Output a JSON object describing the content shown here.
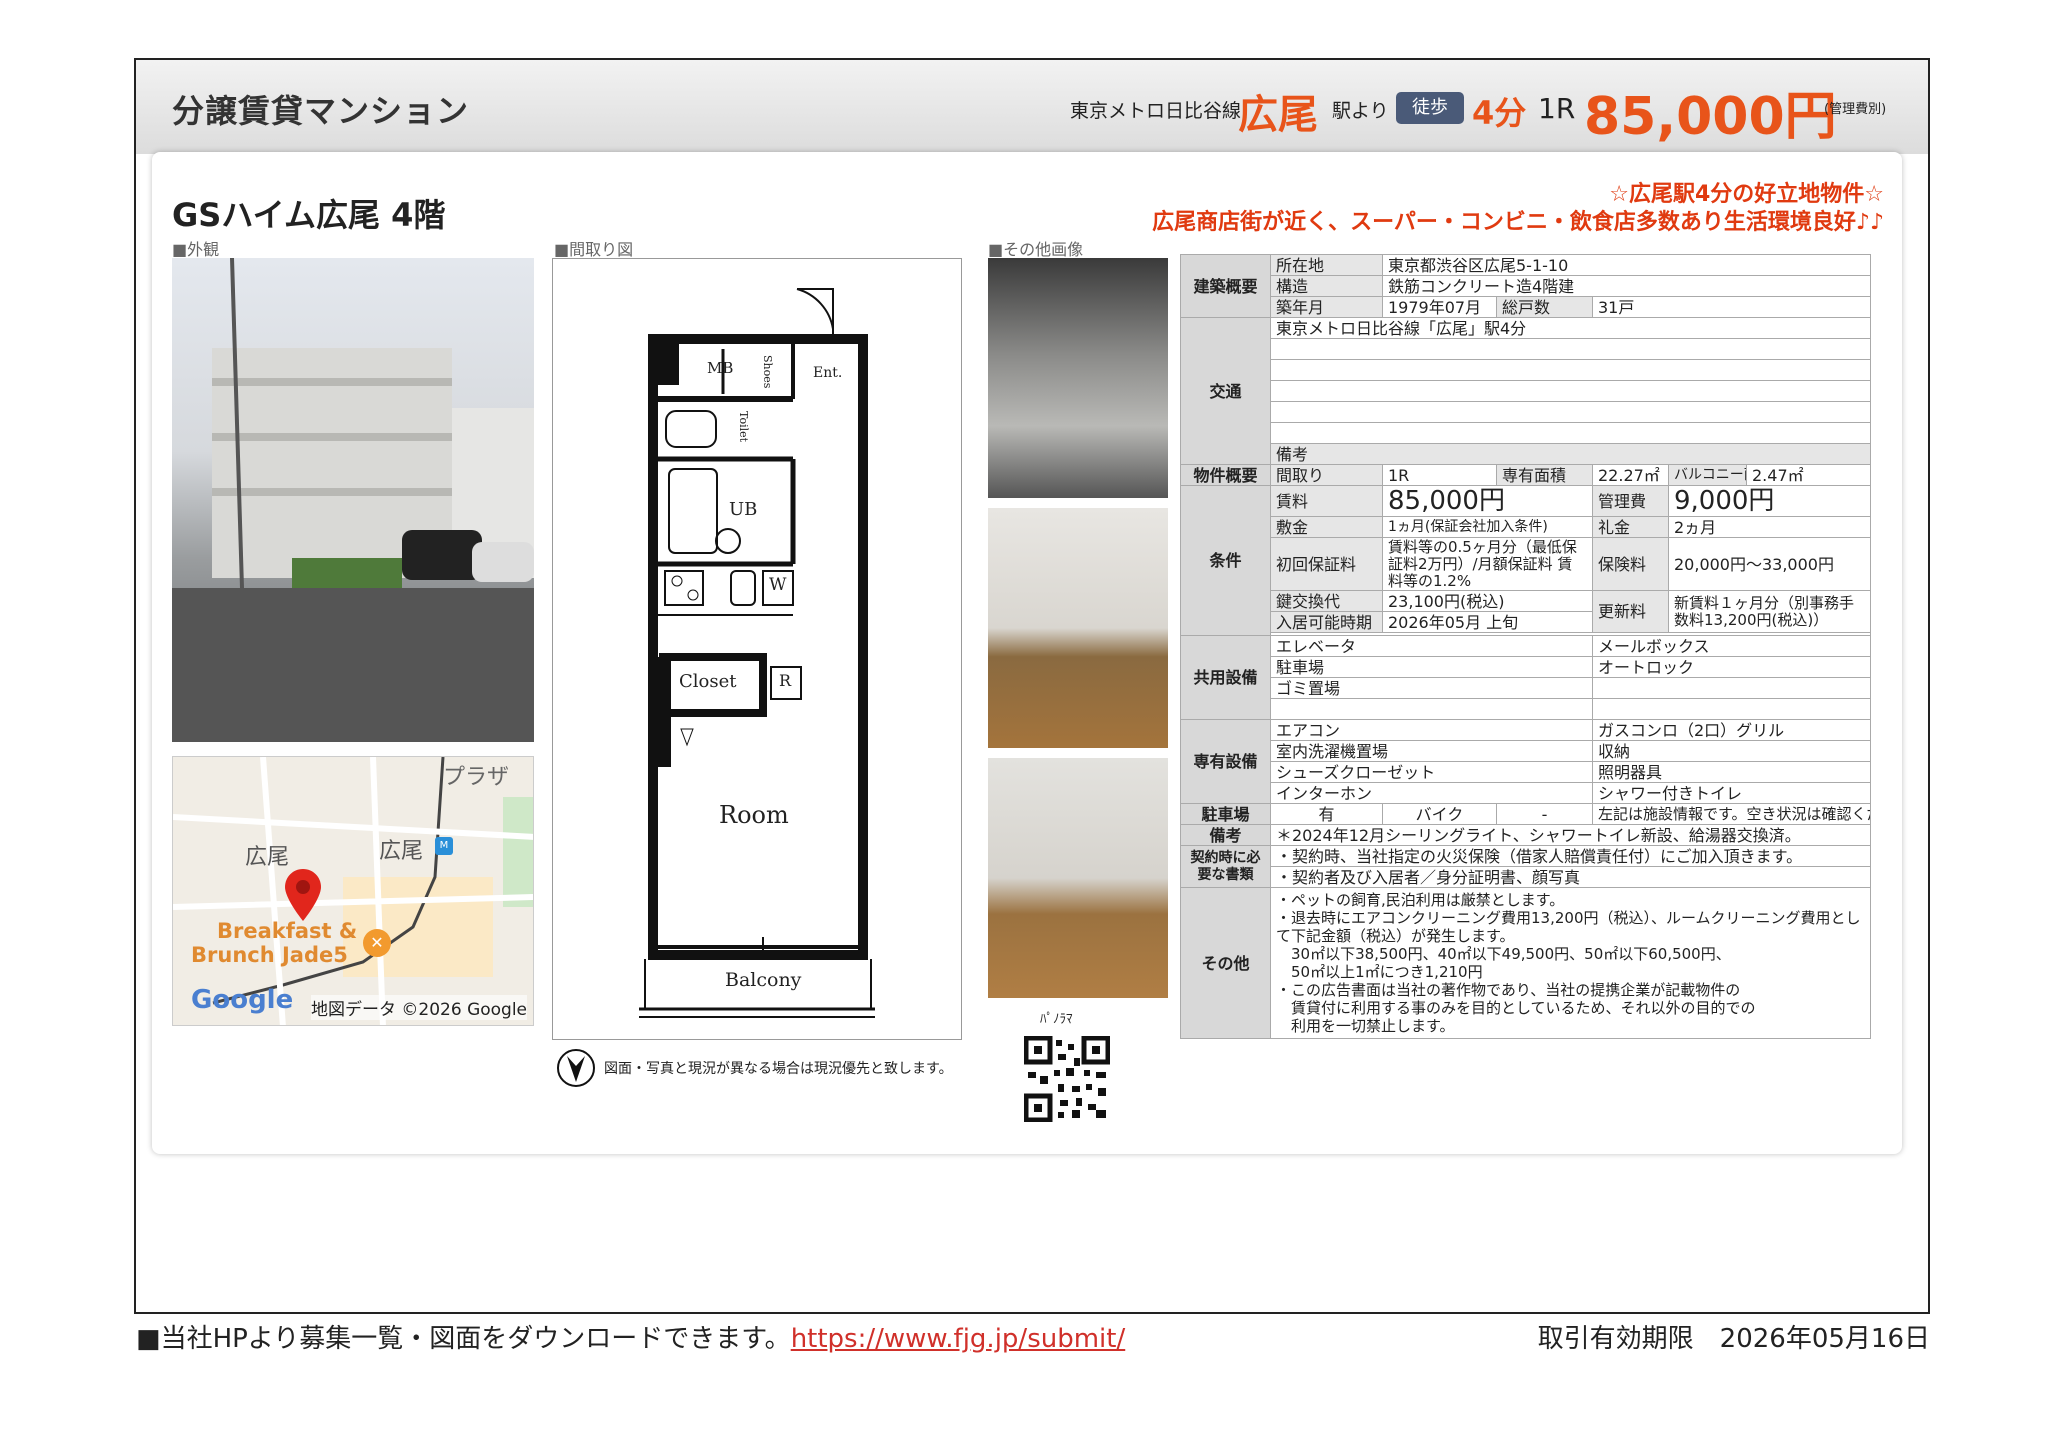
{
  "header": {
    "kind": "分譲賃貸マンション",
    "line": "東京メトロ日比谷線",
    "station": "広尾",
    "from": "駅より",
    "walk": "徒歩",
    "minutes": "4分",
    "layout": "1R",
    "rent": "85,000円",
    "note": "(管理費別)"
  },
  "property": {
    "title": "GSハイム広尾 4階",
    "catch1": "☆広尾駅4分の好立地物件☆",
    "catch2": "広尾商店街が近く、スーパー・コンビニ・飲食店多数あり生活環境良好♪♪"
  },
  "sections": {
    "exterior": "■外観",
    "floorplan": "■間取り図",
    "other": "■その他画像"
  },
  "map": {
    "place1": "広尾",
    "place2": "広尾",
    "poi": "Breakfast &",
    "poi2": "Brunch Jade5",
    "plaza": "プラザ",
    "logo": "Google",
    "credit": "地図データ ©2026 Google"
  },
  "floorplan": {
    "mb": "MB",
    "shoes": "Shoes",
    "ent": "Ent.",
    "toilet": "Toilet",
    "ub": "UB",
    "w": "W",
    "closet": "Closet",
    "r": "R",
    "room": "Room",
    "balcony": "Balcony",
    "note": "図面・写真と現況が異なる場合は現況優先と致します。"
  },
  "panorama": "ﾊﾟﾉﾗﾏ",
  "spec": {
    "kenchiku": "建築概要",
    "shozaichi_l": "所在地",
    "shozaichi": "東京都渋谷区広尾5-1-10",
    "kozo_l": "構造",
    "kozo": "鉄筋コンクリート造4階建",
    "chiku_l": "築年月",
    "chiku": "1979年07月",
    "soko_l": "総戸数",
    "soko": "31戸",
    "kotsu_l": "交通",
    "kotsu1": "東京メトロ日比谷線「広尾」駅4分",
    "biko_l": "備考",
    "bukken_l": "物件概要",
    "madori_l": "間取り",
    "madori": "1R",
    "senyu_l": "専有面積",
    "senyu": "22.27㎡",
    "balc_l": "バルコニー面積",
    "balc": "2.47㎡",
    "joken_l": "条件",
    "chinryo_l": "賃料",
    "chinryo": "85,000円",
    "kanri_l": "管理費",
    "kanri": "9,000円",
    "shikikin_l": "敷金",
    "shikikin": "1ヵ月(保証会社加入条件)",
    "reikin_l": "礼金",
    "reikin": "2ヵ月",
    "hosho_l": "初回保証料",
    "hosho": "賃料等の0.5ヶ月分（最低保証料2万円）/月額保証料 賃料等の1.2%",
    "hoken_l": "保険料",
    "hoken": "20,000円～33,000円",
    "kagi_l": "鍵交換代",
    "kagi": "23,100円(税込)",
    "koshin_l": "更新料",
    "koshin": "新賃料１ヶ月分（別事務手数料13,200円(税込)）",
    "nyukyo_l": "入居可能時期",
    "nyukyo": "2026年05月 上旬",
    "kyoyo_l": "共用設備",
    "kyoyo1": "エレベータ",
    "kyoyo2": "メールボックス",
    "kyoyo3": "駐車場",
    "kyoyo4": "オートロック",
    "kyoyo5": "ゴミ置場",
    "senyo_l": "専有設備",
    "senyo1": "エアコン",
    "senyo2": "ガスコンロ（2口）グリル",
    "senyo3": "室内洗濯機置場",
    "senyo4": "収納",
    "senyo5": "シューズクローゼット",
    "senyo6": "照明器具",
    "senyo7": "インターホン",
    "senyo8": "シャワー付きトイレ",
    "parking_l": "駐車場",
    "parking_a": "有",
    "parking_b": "バイク",
    "parking_c": "-",
    "parking_note": "左記は施設情報です。空き状況は確認ください",
    "biko2_l": "備考",
    "biko2": "＊2024年12月シーリングライト、シャワートイレ新設、給湯器交換済。",
    "keiyaku_l": "契約時に必要な書類",
    "keiyaku1": "・契約時、当社指定の火災保険（借家人賠償責任付）にご加入頂きます。",
    "keiyaku2": "・契約者及び入居者／身分証明書、顔写真",
    "sonota_l": "その他",
    "sonota": "・ペットの飼育,民泊利用は厳禁とします。\n・退去時にエアコンクリーニング費用13,200円（税込）、ルームクリーニング費用として下記金額（税込）が発生します。\n　30㎡以下38,500円、40㎡以下49,500円、50㎡以下60,500円、\n　50㎡以上1㎡につき1,210円\n・この広告書面は当社の著作物であり、当社の提携企業が記載物件の\n　賃貸付に利用する事のみを目的としているため、それ以外の目的での\n　利用を一切禁止します。"
  },
  "footer": {
    "left": "■当社HPより募集一覧・図面をダウンロードできます。",
    "url": "https://www.fjg.jp/submit/",
    "right": "取引有効期限　2026年05月16日"
  },
  "colors": {
    "accent": "#e8541a",
    "walk_badge": "#4a5a78",
    "catch": "#e03a10",
    "link": "#d0302a"
  }
}
